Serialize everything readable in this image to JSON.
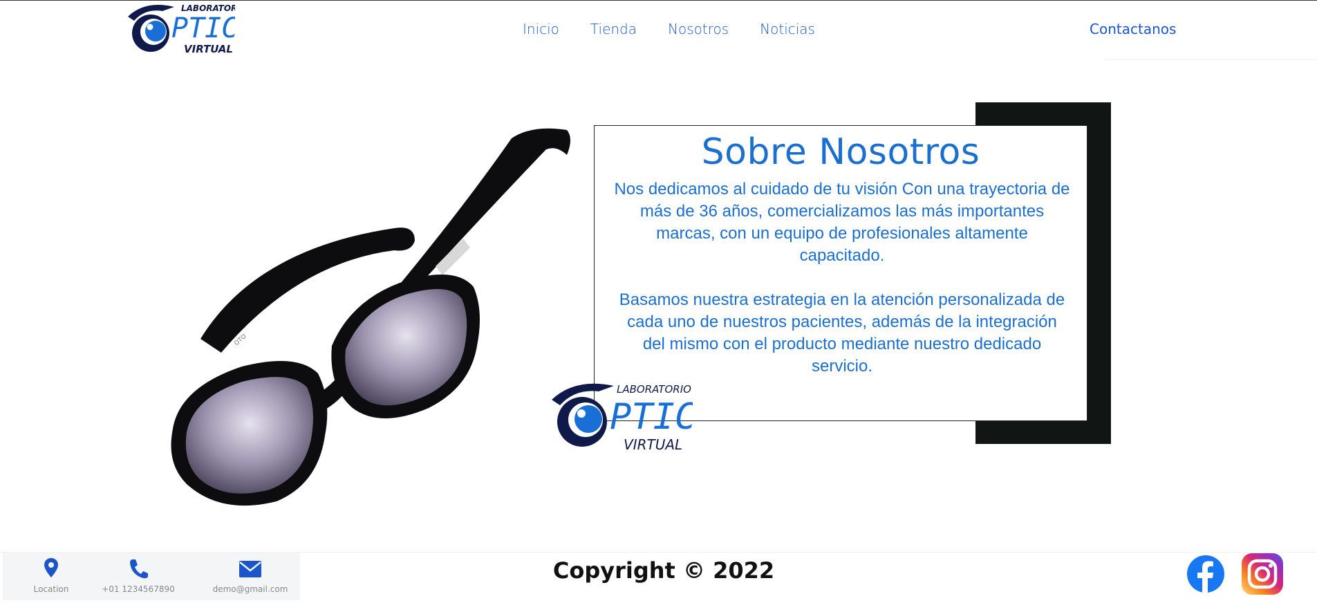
{
  "brand": {
    "top_word": "LABORATORIO",
    "main_word": "PTICO",
    "bottom_word": "VIRTUAL"
  },
  "nav": {
    "items": [
      "Inicio",
      "Tienda",
      "Nosotros",
      "Noticias"
    ],
    "contact_label": "Contactanos"
  },
  "about": {
    "title": "Sobre Nosotros",
    "paragraph1": "Nos dedicamos al cuidado de tu visión Con una trayectoria de más de 36 años, comercializamos las más importantes marcas, con un equipo de profesionales altamente capacitado.",
    "paragraph2": "Basamos nuestra estrategia en la atención personalizada de cada uno de nuestros pacientes, además de la integración del mismo con el producto mediante nuestro dedicado servicio."
  },
  "glasses_temple_text": "OTO",
  "footer": {
    "contacts": [
      {
        "icon": "location-pin-icon",
        "label": "Location"
      },
      {
        "icon": "phone-icon",
        "label": "+01 1234567890"
      },
      {
        "icon": "envelope-icon",
        "label": "demo@gmail.com"
      }
    ],
    "copyright": "Copyright © 2022",
    "social": [
      "facebook-icon",
      "instagram-icon"
    ]
  },
  "colors": {
    "brand_blue": "#1a56c9",
    "title_blue": "#1b6fcf",
    "logo_dark": "#101a4a",
    "frame_black": "#111513"
  }
}
